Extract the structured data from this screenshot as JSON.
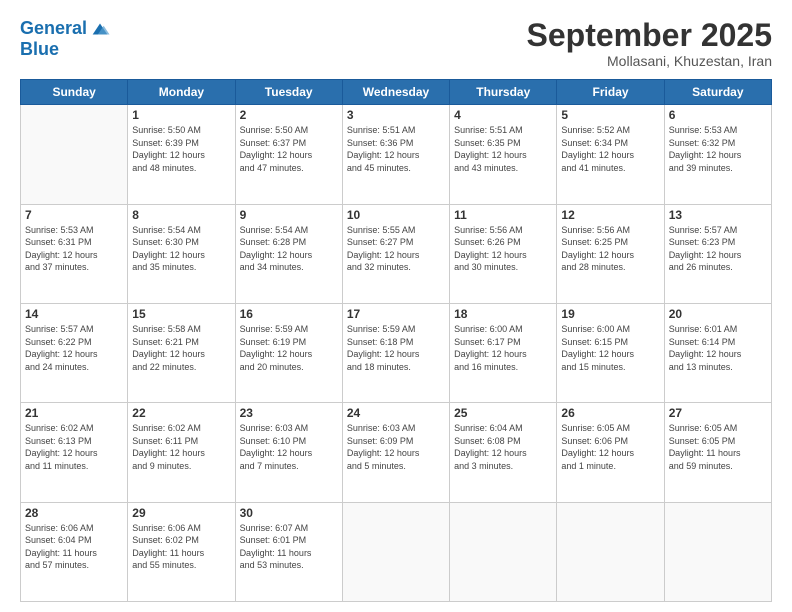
{
  "header": {
    "logo_line1": "General",
    "logo_line2": "Blue",
    "month": "September 2025",
    "location": "Mollasani, Khuzestan, Iran"
  },
  "weekdays": [
    "Sunday",
    "Monday",
    "Tuesday",
    "Wednesday",
    "Thursday",
    "Friday",
    "Saturday"
  ],
  "weeks": [
    [
      {
        "day": "",
        "text": ""
      },
      {
        "day": "1",
        "text": "Sunrise: 5:50 AM\nSunset: 6:39 PM\nDaylight: 12 hours\nand 48 minutes."
      },
      {
        "day": "2",
        "text": "Sunrise: 5:50 AM\nSunset: 6:37 PM\nDaylight: 12 hours\nand 47 minutes."
      },
      {
        "day": "3",
        "text": "Sunrise: 5:51 AM\nSunset: 6:36 PM\nDaylight: 12 hours\nand 45 minutes."
      },
      {
        "day": "4",
        "text": "Sunrise: 5:51 AM\nSunset: 6:35 PM\nDaylight: 12 hours\nand 43 minutes."
      },
      {
        "day": "5",
        "text": "Sunrise: 5:52 AM\nSunset: 6:34 PM\nDaylight: 12 hours\nand 41 minutes."
      },
      {
        "day": "6",
        "text": "Sunrise: 5:53 AM\nSunset: 6:32 PM\nDaylight: 12 hours\nand 39 minutes."
      }
    ],
    [
      {
        "day": "7",
        "text": "Sunrise: 5:53 AM\nSunset: 6:31 PM\nDaylight: 12 hours\nand 37 minutes."
      },
      {
        "day": "8",
        "text": "Sunrise: 5:54 AM\nSunset: 6:30 PM\nDaylight: 12 hours\nand 35 minutes."
      },
      {
        "day": "9",
        "text": "Sunrise: 5:54 AM\nSunset: 6:28 PM\nDaylight: 12 hours\nand 34 minutes."
      },
      {
        "day": "10",
        "text": "Sunrise: 5:55 AM\nSunset: 6:27 PM\nDaylight: 12 hours\nand 32 minutes."
      },
      {
        "day": "11",
        "text": "Sunrise: 5:56 AM\nSunset: 6:26 PM\nDaylight: 12 hours\nand 30 minutes."
      },
      {
        "day": "12",
        "text": "Sunrise: 5:56 AM\nSunset: 6:25 PM\nDaylight: 12 hours\nand 28 minutes."
      },
      {
        "day": "13",
        "text": "Sunrise: 5:57 AM\nSunset: 6:23 PM\nDaylight: 12 hours\nand 26 minutes."
      }
    ],
    [
      {
        "day": "14",
        "text": "Sunrise: 5:57 AM\nSunset: 6:22 PM\nDaylight: 12 hours\nand 24 minutes."
      },
      {
        "day": "15",
        "text": "Sunrise: 5:58 AM\nSunset: 6:21 PM\nDaylight: 12 hours\nand 22 minutes."
      },
      {
        "day": "16",
        "text": "Sunrise: 5:59 AM\nSunset: 6:19 PM\nDaylight: 12 hours\nand 20 minutes."
      },
      {
        "day": "17",
        "text": "Sunrise: 5:59 AM\nSunset: 6:18 PM\nDaylight: 12 hours\nand 18 minutes."
      },
      {
        "day": "18",
        "text": "Sunrise: 6:00 AM\nSunset: 6:17 PM\nDaylight: 12 hours\nand 16 minutes."
      },
      {
        "day": "19",
        "text": "Sunrise: 6:00 AM\nSunset: 6:15 PM\nDaylight: 12 hours\nand 15 minutes."
      },
      {
        "day": "20",
        "text": "Sunrise: 6:01 AM\nSunset: 6:14 PM\nDaylight: 12 hours\nand 13 minutes."
      }
    ],
    [
      {
        "day": "21",
        "text": "Sunrise: 6:02 AM\nSunset: 6:13 PM\nDaylight: 12 hours\nand 11 minutes."
      },
      {
        "day": "22",
        "text": "Sunrise: 6:02 AM\nSunset: 6:11 PM\nDaylight: 12 hours\nand 9 minutes."
      },
      {
        "day": "23",
        "text": "Sunrise: 6:03 AM\nSunset: 6:10 PM\nDaylight: 12 hours\nand 7 minutes."
      },
      {
        "day": "24",
        "text": "Sunrise: 6:03 AM\nSunset: 6:09 PM\nDaylight: 12 hours\nand 5 minutes."
      },
      {
        "day": "25",
        "text": "Sunrise: 6:04 AM\nSunset: 6:08 PM\nDaylight: 12 hours\nand 3 minutes."
      },
      {
        "day": "26",
        "text": "Sunrise: 6:05 AM\nSunset: 6:06 PM\nDaylight: 12 hours\nand 1 minute."
      },
      {
        "day": "27",
        "text": "Sunrise: 6:05 AM\nSunset: 6:05 PM\nDaylight: 11 hours\nand 59 minutes."
      }
    ],
    [
      {
        "day": "28",
        "text": "Sunrise: 6:06 AM\nSunset: 6:04 PM\nDaylight: 11 hours\nand 57 minutes."
      },
      {
        "day": "29",
        "text": "Sunrise: 6:06 AM\nSunset: 6:02 PM\nDaylight: 11 hours\nand 55 minutes."
      },
      {
        "day": "30",
        "text": "Sunrise: 6:07 AM\nSunset: 6:01 PM\nDaylight: 11 hours\nand 53 minutes."
      },
      {
        "day": "",
        "text": ""
      },
      {
        "day": "",
        "text": ""
      },
      {
        "day": "",
        "text": ""
      },
      {
        "day": "",
        "text": ""
      }
    ]
  ]
}
